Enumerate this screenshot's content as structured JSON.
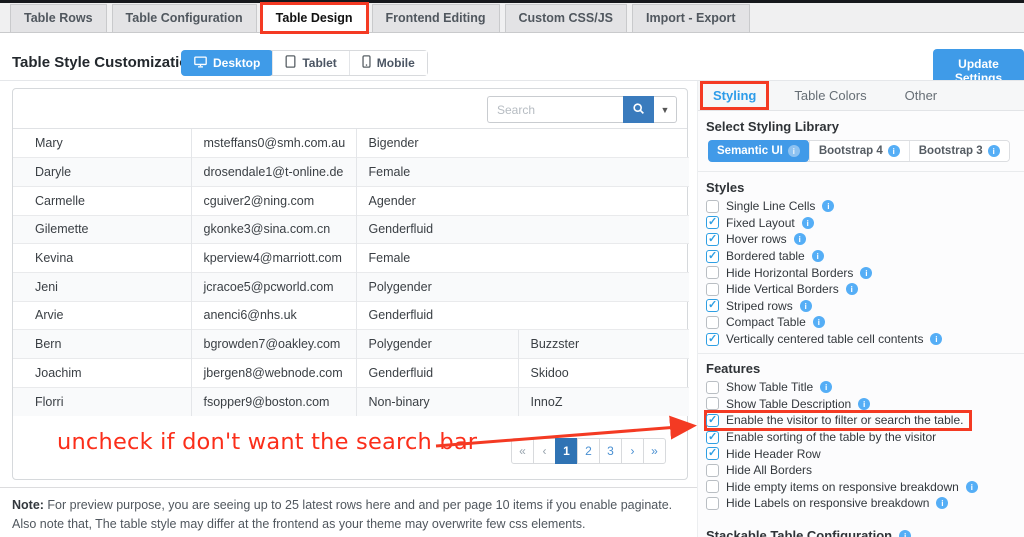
{
  "colors": {
    "accent": "#3f9be8",
    "highlight_red": "#f43a23",
    "search_button_blue": "#3a7bbd",
    "pagination_active_blue": "#2f73b4"
  },
  "top_tabs": [
    {
      "label": "Table Rows",
      "active": false
    },
    {
      "label": "Table Configuration",
      "active": false
    },
    {
      "label": "Table Design",
      "active": true,
      "highlighted": true
    },
    {
      "label": "Frontend Editing",
      "active": false
    },
    {
      "label": "Custom CSS/JS",
      "active": false
    },
    {
      "label": "Import - Export",
      "active": false
    }
  ],
  "header": {
    "title": "Table Style Customization",
    "devices": [
      {
        "label": "Desktop",
        "active": true
      },
      {
        "label": "Tablet",
        "active": false
      },
      {
        "label": "Mobile",
        "active": false
      }
    ],
    "update_button": "Update Settings"
  },
  "preview": {
    "search_placeholder": "Search",
    "rows": [
      {
        "name": "Mary",
        "email": "msteffans0@smh.com.au",
        "gender": "Bigender",
        "company": null
      },
      {
        "name": "Daryle",
        "email": "drosendale1@t-online.de",
        "gender": "Female",
        "company": null
      },
      {
        "name": "Carmelle",
        "email": "cguiver2@ning.com",
        "gender": "Agender",
        "company": null
      },
      {
        "name": "Gilemette",
        "email": "gkonke3@sina.com.cn",
        "gender": "Genderfluid",
        "company": null
      },
      {
        "name": "Kevina",
        "email": "kperview4@marriott.com",
        "gender": "Female",
        "company": null
      },
      {
        "name": "Jeni",
        "email": "jcracoe5@pcworld.com",
        "gender": "Polygender",
        "company": null
      },
      {
        "name": "Arvie",
        "email": "anenci6@nhs.uk",
        "gender": "Genderfluid",
        "company": null
      },
      {
        "name": "Bern",
        "email": "bgrowden7@oakley.com",
        "gender": "Polygender",
        "company": "Buzzster"
      },
      {
        "name": "Joachim",
        "email": "jbergen8@webnode.com",
        "gender": "Genderfluid",
        "company": "Skidoo"
      },
      {
        "name": "Florri",
        "email": "fsopper9@boston.com",
        "gender": "Non-binary",
        "company": "InnoZ"
      }
    ],
    "pagination": [
      {
        "label": "«",
        "muted": true
      },
      {
        "label": "‹",
        "muted": true
      },
      {
        "label": "1",
        "active": true
      },
      {
        "label": "2"
      },
      {
        "label": "3"
      },
      {
        "label": "›"
      },
      {
        "label": "»"
      }
    ]
  },
  "annotation": {
    "text": "uncheck if don't want the search bar"
  },
  "note": {
    "prefix": "Note:",
    "body": " For preview purpose, you are seeing up to 25 latest rows here and and per page 10 items if you enable paginate. Also note that, The table style may differ at the frontend as your theme may overwrite few css elements."
  },
  "panel": {
    "tabs": [
      {
        "label": "Styling",
        "active": true,
        "highlighted": true
      },
      {
        "label": "Table Colors",
        "active": false
      },
      {
        "label": "Other",
        "active": false
      }
    ],
    "library": {
      "heading": "Select Styling Library",
      "options": [
        {
          "label": "Semantic UI",
          "active": true,
          "info": true
        },
        {
          "label": "Bootstrap 4",
          "active": false,
          "info": true
        },
        {
          "label": "Bootstrap 3",
          "active": false,
          "info": true
        }
      ]
    },
    "styles": {
      "heading": "Styles",
      "items": [
        {
          "label": "Single Line Cells",
          "checked": false,
          "info": true
        },
        {
          "label": "Fixed Layout",
          "checked": true,
          "info": true
        },
        {
          "label": "Hover rows",
          "checked": true,
          "info": true
        },
        {
          "label": "Bordered table",
          "checked": true,
          "info": true
        },
        {
          "label": "Hide Horizontal Borders",
          "checked": false,
          "info": true
        },
        {
          "label": "Hide Vertical Borders",
          "checked": false,
          "info": true
        },
        {
          "label": "Striped rows",
          "checked": true,
          "info": true
        },
        {
          "label": "Compact Table",
          "checked": false,
          "info": true
        },
        {
          "label": "Vertically centered table cell contents",
          "checked": true,
          "info": true
        }
      ]
    },
    "features": {
      "heading": "Features",
      "items": [
        {
          "label": "Show Table Title",
          "checked": false,
          "info": true
        },
        {
          "label": "Show Table Description",
          "checked": false,
          "info": true
        },
        {
          "label": "Enable the visitor to filter or search the table.",
          "checked": true,
          "boxed": true
        },
        {
          "label": "Enable sorting of the table by the visitor",
          "checked": true
        },
        {
          "label": "Hide Header Row",
          "checked": true
        },
        {
          "label": "Hide All Borders",
          "checked": false
        },
        {
          "label": "Hide empty items on responsive breakdown",
          "checked": false,
          "info": true
        },
        {
          "label": "Hide Labels on responsive breakdown",
          "checked": false,
          "info": true
        }
      ]
    },
    "bottom_heading": "Stackable Table Configuration"
  }
}
